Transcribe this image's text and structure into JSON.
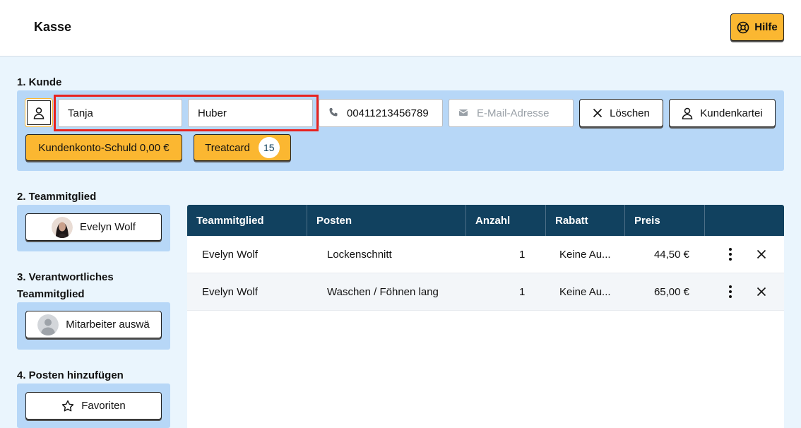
{
  "header": {
    "title": "Kasse",
    "help_label": "Hilfe"
  },
  "customer": {
    "section_label": "1. Kunde",
    "first_name": "Tanja",
    "last_name": "Huber",
    "phone": "00411213456789",
    "email_placeholder": "E-Mail-Adresse",
    "clear_label": "Löschen",
    "card_label": "Kundenkartei",
    "debt_label": "Kundenkonto-Schuld 0,00 €",
    "treatcard_label": "Treatcard",
    "treatcard_count": "15"
  },
  "team": {
    "section_label": "2. Teammitglied",
    "member_name": "Evelyn Wolf"
  },
  "responsible": {
    "section_label_line1": "3. Verantwortliches",
    "section_label_line2": "Teammitglied",
    "select_label": "Mitarbeiter auswä"
  },
  "add_items": {
    "section_label": "4. Posten hinzufügen",
    "favorites_label": "Favoriten"
  },
  "table": {
    "headers": [
      "Teammitglied",
      "Posten",
      "Anzahl",
      "Rabatt",
      "Preis"
    ],
    "rows": [
      {
        "member": "Evelyn Wolf",
        "item": "Lockenschnitt",
        "qty": "1",
        "discount": "Keine Au...",
        "price": "44,50 €"
      },
      {
        "member": "Evelyn Wolf",
        "item": "Waschen / Föhnen lang",
        "qty": "1",
        "discount": "Keine Au...",
        "price": "65,00 €"
      }
    ]
  },
  "colors": {
    "accent": "#fbb731",
    "panel": "#b7d7f7",
    "table_header": "#11415f",
    "highlight": "#e8221f",
    "background": "#eaf5fd"
  }
}
